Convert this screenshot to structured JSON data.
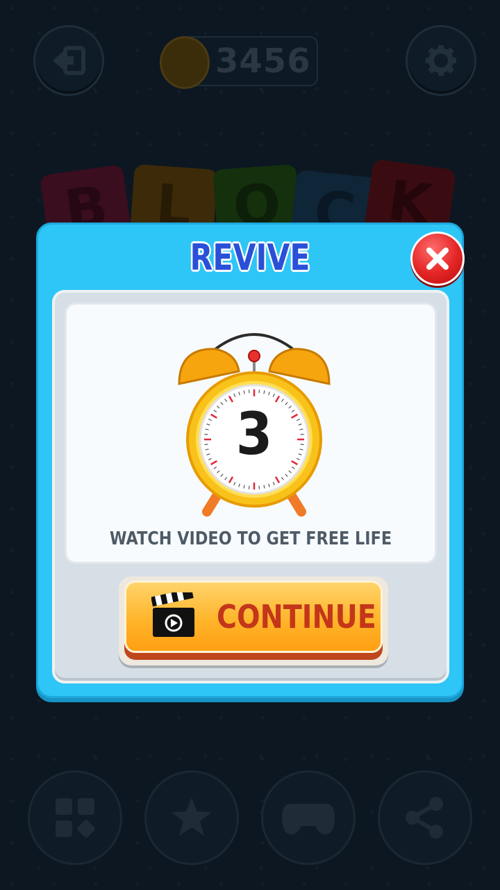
{
  "top_bar": {
    "coins": "3456"
  },
  "logo": {
    "letters": [
      "B",
      "L",
      "O",
      "C",
      "K"
    ]
  },
  "dialog": {
    "title": "REVIVE",
    "countdown": "3",
    "message": "WATCH VIDEO TO GET FREE LIFE",
    "continue_label": "CONTINUE"
  },
  "icons": {
    "exit": "exit-icon",
    "coin": "coin-icon",
    "settings": "gear-icon",
    "close": "close-icon",
    "clock": "alarm-clock-icon",
    "clapper": "clapperboard-icon",
    "nav": [
      "blocks-icon",
      "star-icon",
      "gamepad-icon",
      "share-icon"
    ]
  },
  "colors": {
    "dialog_bg": "#2ec6f6",
    "title": "#2a50d8",
    "continue_button": "#ffb52b",
    "continue_text": "#c4361a",
    "close_button": "#e32424"
  }
}
